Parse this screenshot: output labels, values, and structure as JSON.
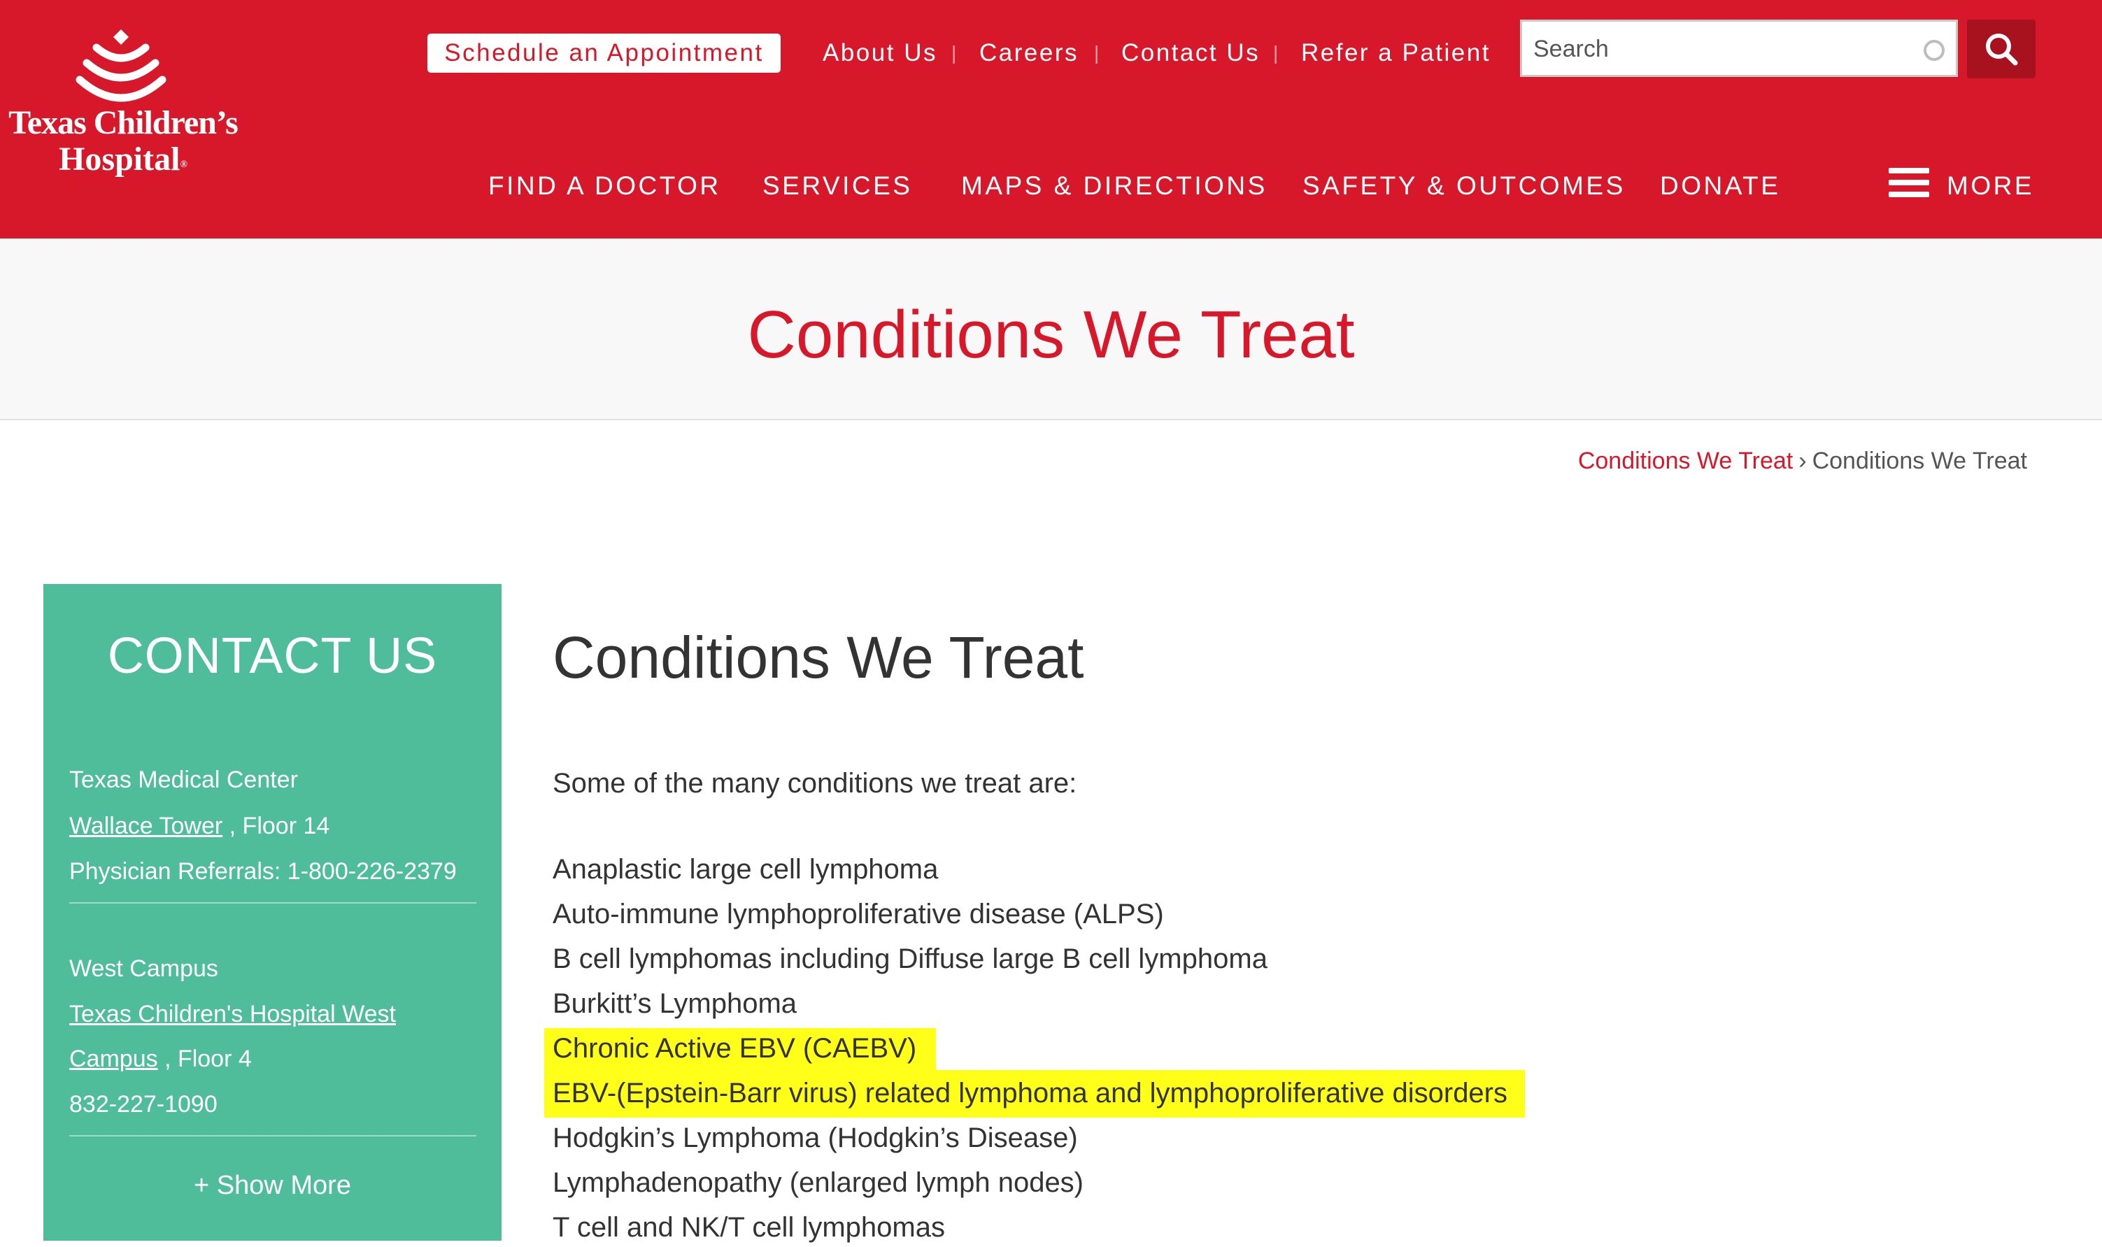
{
  "header": {
    "logo": {
      "line1": "Texas Children’s",
      "line2": "Hospital",
      "mark": "®"
    },
    "appointment_label": "Schedule an Appointment",
    "utility_links": [
      "About Us",
      "Careers",
      "Contact Us",
      "Refer a Patient"
    ],
    "utility_separator": "|",
    "search": {
      "placeholder": "Search"
    },
    "main_nav": [
      "FIND A DOCTOR",
      "SERVICES",
      "MAPS & DIRECTIONS",
      "SAFETY & OUTCOMES",
      "DONATE"
    ],
    "more_label": "MORE",
    "brand_color": "#d7182a"
  },
  "page_title": "Conditions We Treat",
  "breadcrumb": {
    "parent": "Conditions We Treat",
    "separator": "›",
    "current": "Conditions We Treat"
  },
  "sidebar": {
    "heading": "CONTACT US",
    "location1": {
      "name": "Texas Medical Center",
      "building": "Wallace Tower",
      "floor": ", Floor 14",
      "phone": "Physician Referrals: 1-800-226-2379"
    },
    "location2": {
      "name": "West Campus",
      "building_line1": "Texas Children's Hospital West",
      "building_line2": "Campus",
      "floor": ", Floor 4",
      "phone": "832-227-1090"
    },
    "show_more": "+ Show More",
    "color": "#4fbc9a"
  },
  "content": {
    "heading": "Conditions We Treat",
    "intro": "Some of the many conditions we treat are:",
    "conditions": [
      "Anaplastic large cell lymphoma",
      "Auto-immune lymphoproliferative disease (ALPS)",
      "B cell lymphomas including Diffuse large B cell lymphoma",
      "Burkitt’s Lymphoma",
      "Chronic Active EBV (CAEBV)",
      "EBV-(Epstein-Barr virus) related lymphoma and lymphoproliferative disorders",
      "Hodgkin’s Lymphoma (Hodgkin’s Disease)",
      "Lymphadenopathy (enlarged lymph nodes)",
      "T cell and NK/T cell lymphomas"
    ],
    "highlighted_items": [
      "Chronic Active EBV (CAEBV)",
      "EBV-(Epstein-Barr virus) related lymphoma and lymphoproliferative disorders"
    ],
    "highlight_color": "#ffff1a"
  }
}
